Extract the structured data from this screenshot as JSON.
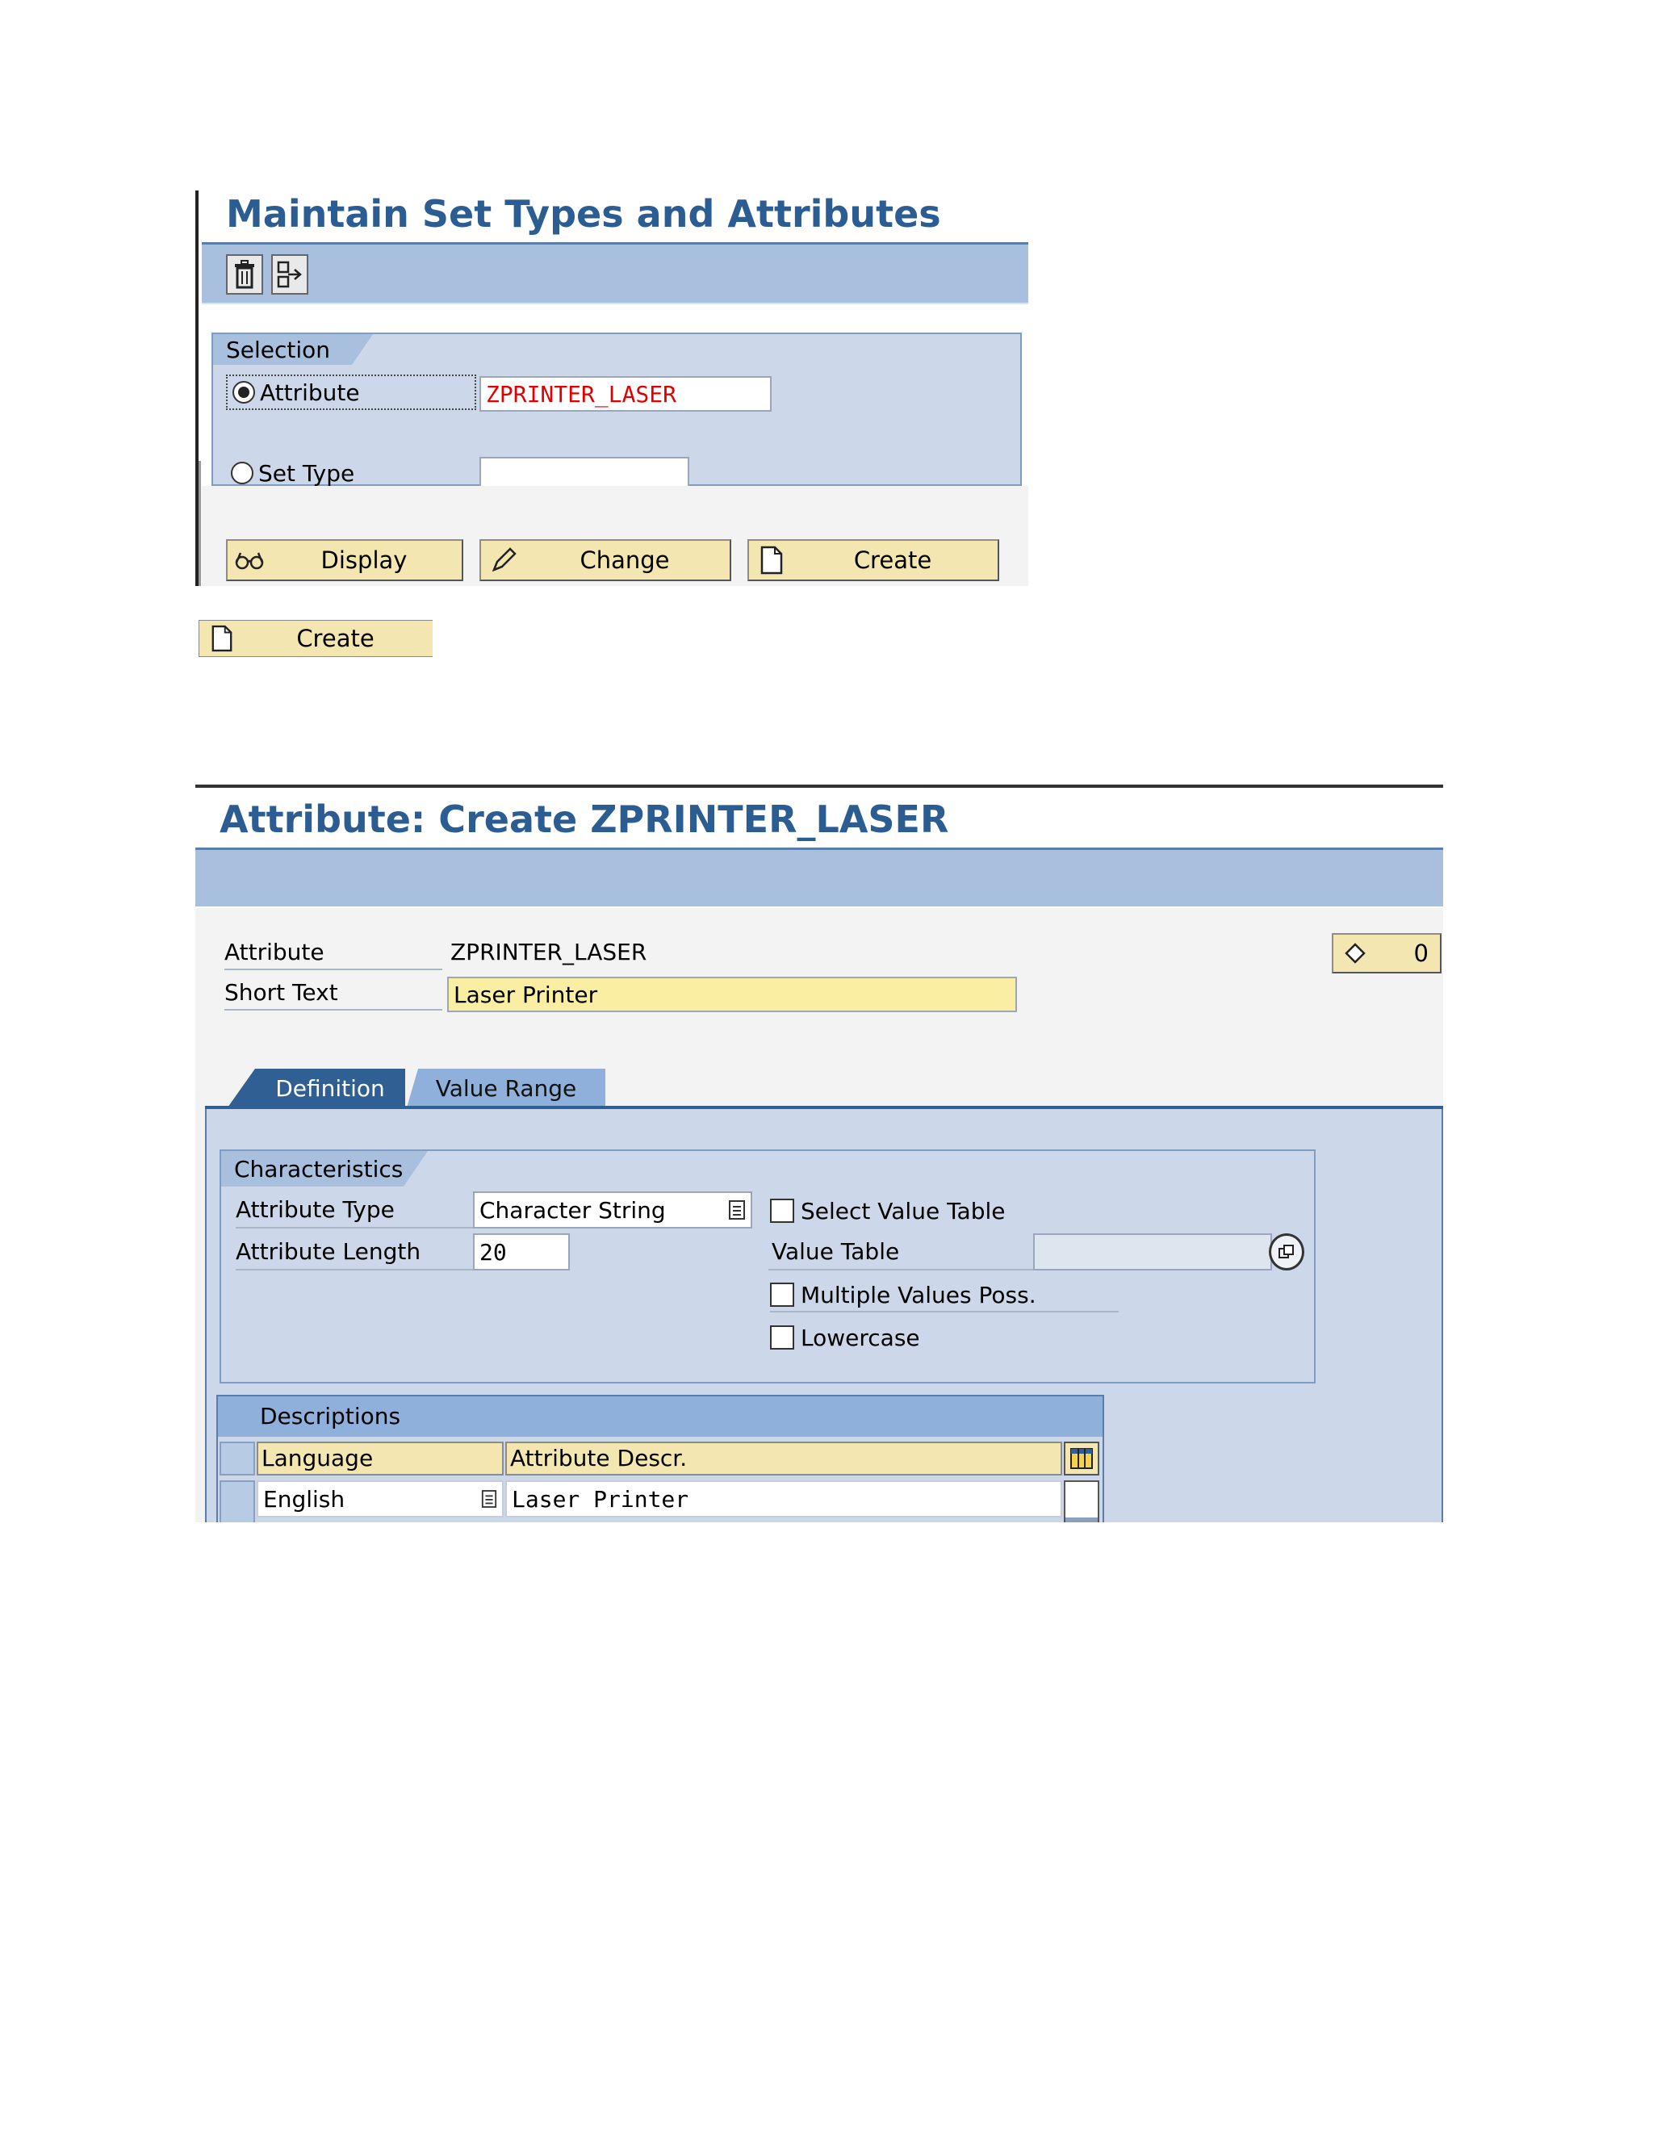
{
  "screen1": {
    "title": "Maintain Set Types and Attributes",
    "toolbar": {
      "delete_icon": "trash-icon",
      "transport_icon": "transport-icon"
    },
    "selection_tab": "Selection",
    "attribute_label": "Attribute",
    "attribute_value": "ZPRINTER_LASER",
    "settype_label": "Set Type",
    "settype_value": "",
    "buttons": {
      "display": "Display",
      "change": "Change",
      "create": "Create"
    }
  },
  "standalone_button": {
    "label": "Create"
  },
  "screen2": {
    "title": "Attribute: Create ZPRINTER_LASER",
    "attribute_label": "Attribute",
    "attribute_value": "ZPRINTER_LASER",
    "short_text_label": "Short Text",
    "short_text_value": "Laser Printer",
    "counter_value": "0",
    "tabs": {
      "definition": "Definition",
      "value_range": "Value Range"
    },
    "characteristics": {
      "title": "Characteristics",
      "attr_type_label": "Attribute Type",
      "attr_type_value": "Character String",
      "attr_length_label": "Attribute Length",
      "attr_length_value": "20",
      "select_value_table": "Select Value Table",
      "value_table_label": "Value Table",
      "value_table_value": "",
      "multiple_values": "Multiple Values Poss.",
      "lowercase": "Lowercase"
    },
    "descriptions": {
      "title": "Descriptions",
      "columns": [
        "Language",
        "Attribute Descr."
      ],
      "rows": [
        {
          "language": "English",
          "descr": "Laser Printer"
        }
      ]
    }
  },
  "colors": {
    "sap_blue_title": "#2b5d93",
    "toolbar_blue": "#a8c0de",
    "panel_blue": "#ccd8ea",
    "button_yellow": "#f4e6b0",
    "required_yellow": "#faeea3",
    "value_red": "#e00000"
  }
}
